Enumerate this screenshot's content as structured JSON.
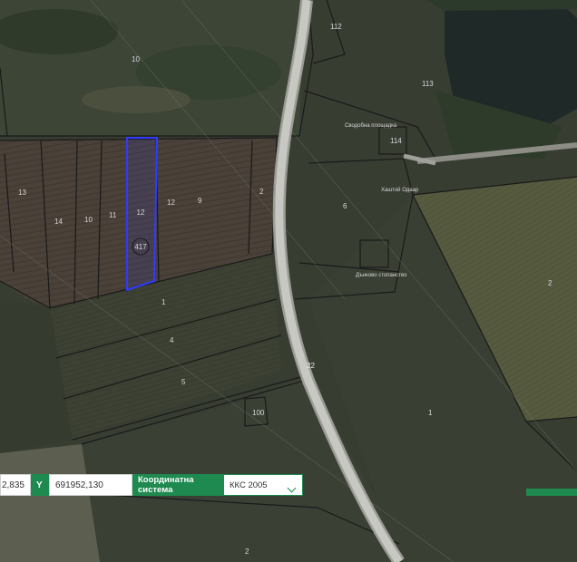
{
  "map": {
    "parcels": [
      {
        "id": "p112",
        "label": "112"
      },
      {
        "id": "p10t",
        "label": "10"
      },
      {
        "id": "p113",
        "label": "113"
      },
      {
        "id": "pkb",
        "label": "Сводобна площадка"
      },
      {
        "id": "p114",
        "label": "114"
      },
      {
        "id": "p13",
        "label": "13"
      },
      {
        "id": "p14",
        "label": "14"
      },
      {
        "id": "p10",
        "label": "10"
      },
      {
        "id": "p11",
        "label": "11"
      },
      {
        "id": "p12",
        "label": "12"
      },
      {
        "id": "p9",
        "label": "9"
      },
      {
        "id": "p2l",
        "label": "2"
      },
      {
        "id": "p6",
        "label": "6"
      },
      {
        "id": "psm",
        "label": "Хаштой Одаар"
      },
      {
        "id": "pbld",
        "label": "Дънково стопанство"
      },
      {
        "id": "p2r",
        "label": "2"
      },
      {
        "id": "p1",
        "label": "1"
      },
      {
        "id": "p4",
        "label": "4"
      },
      {
        "id": "p5",
        "label": "5"
      },
      {
        "id": "p1r",
        "label": "1"
      },
      {
        "id": "p100",
        "label": "100"
      },
      {
        "id": "p2b",
        "label": "2"
      },
      {
        "id": "proad",
        "label": "22"
      }
    ],
    "selected_parcel": {
      "label": "12",
      "badge": "417"
    }
  },
  "coord_bar": {
    "x_value": "2,835",
    "y_label": "Y",
    "y_value": "691952,130",
    "system_label": "Координатна система",
    "system_value": "ККС 2005"
  },
  "colors": {
    "accent": "#1e8a4f",
    "selection": "#2f3bff"
  }
}
